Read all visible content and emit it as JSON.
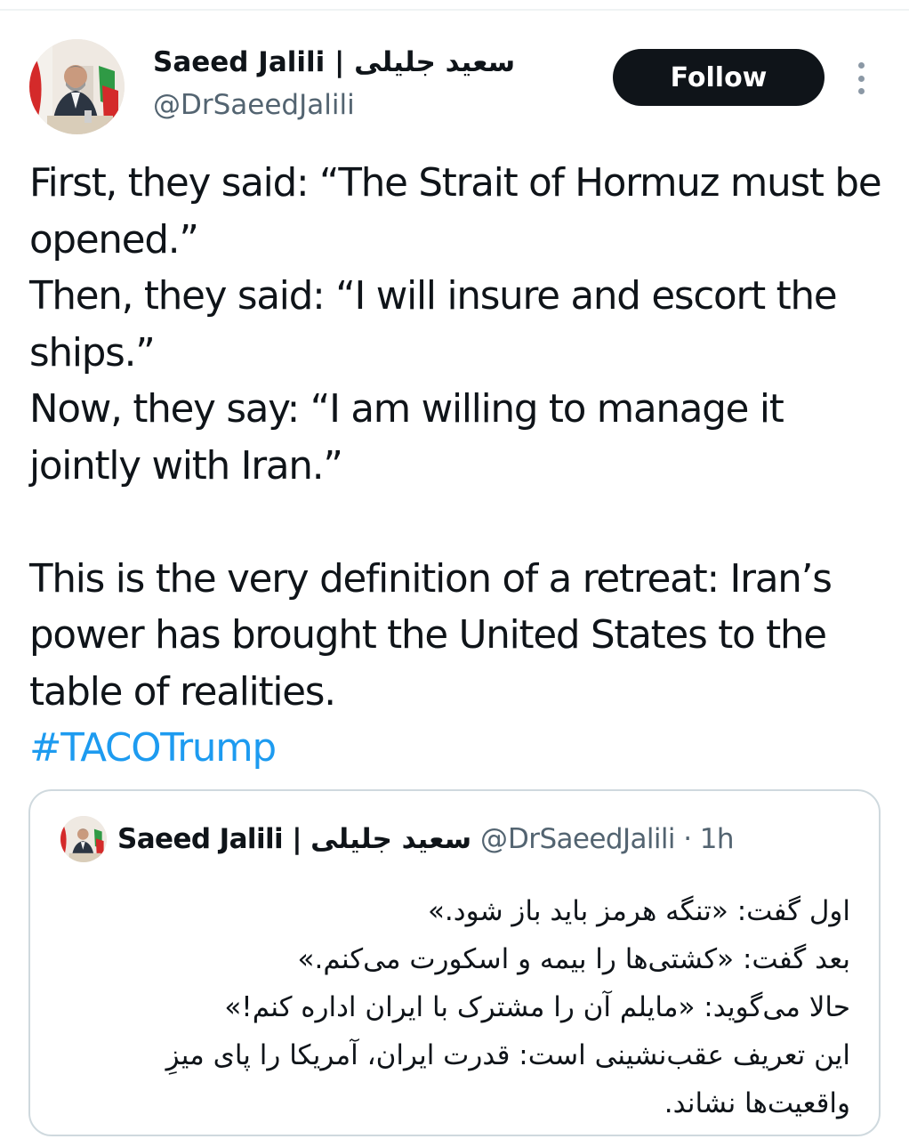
{
  "author": {
    "name": "Saeed Jalili | سعید جلیلی",
    "handle": "@DrSaeedJalili",
    "avatar_icon": "profile-photo"
  },
  "actions": {
    "follow_label": "Follow",
    "more_icon": "more-vertical-icon"
  },
  "tweet": {
    "lines": [
      "First, they said: “The Strait of Hormuz must be opened.”",
      "Then, they said: “I will insure and escort the ships.”",
      "Now, they say: “I am willing to manage it jointly with Iran.”",
      "This is the very definition of a retreat: Iran’s power has brought the United States to the table of realities."
    ],
    "hashtag": "#TACOTrump"
  },
  "quoted": {
    "name": "Saeed Jalili | سعید جلیلی",
    "handle": "@DrSaeedJalili",
    "time": "· 1h",
    "lines": [
      "اول گفت: «تنگه هرمز باید باز شود.»",
      "بعد گفت: «کشتی‌ها را بیمه و اسکورت می‌کنم.»",
      "حالا می‌گوید: «مایلم آن را مشترک با ایران اداره کنم!»",
      "این تعریف عقب‌نشینی است: قدرت ایران، آمریکا را پای میزِ واقعیت‌ها نشاند."
    ]
  },
  "colors": {
    "text": "#0f1419",
    "secondary": "#536471",
    "link": "#1d9bf0",
    "button_bg": "#0f1419",
    "border": "#cfd9de"
  }
}
